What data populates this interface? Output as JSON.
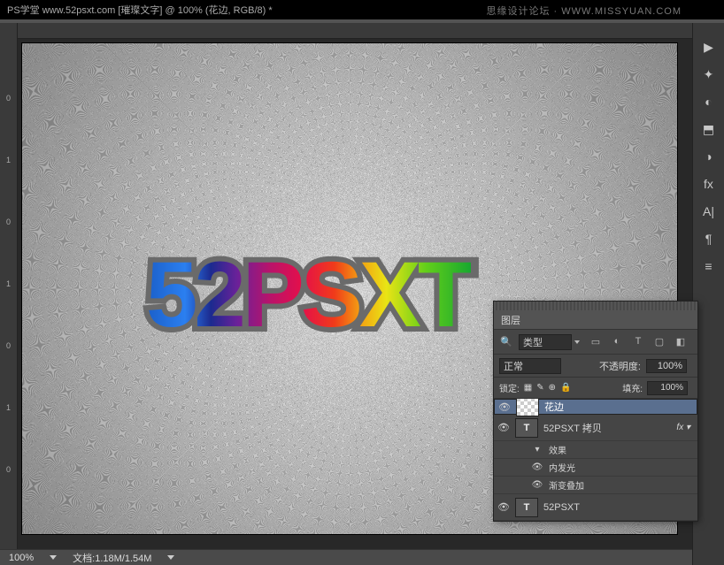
{
  "window": {
    "title": "PS学堂 www.52psxt.com [璀璨文字] @ 100% (花边, RGB/8) *"
  },
  "watermark": "思缘设计论坛 · WWW.MISSYUAN.COM",
  "canvas": {
    "text": "52PSXT"
  },
  "status": {
    "zoom": "100%",
    "doc": "文档:1.18M/1.54M"
  },
  "ruler_left": [
    "0",
    "1",
    "0",
    "1",
    "0",
    "1",
    "0"
  ],
  "tool_icons": [
    "▶",
    "✦",
    "◐",
    "⬒",
    "◑",
    "fx",
    "A|",
    "¶",
    "≡"
  ],
  "layers_panel": {
    "tab": "图层",
    "search": {
      "label": "类型"
    },
    "icons_row": [
      "▭",
      "◐",
      "T",
      "▢",
      "◧"
    ],
    "blend": "正常",
    "opacity_label": "不透明度:",
    "opacity_value": "100%",
    "lock_label": "锁定:",
    "lock_icons": [
      "▦",
      "✎",
      "⊕",
      "🔒"
    ],
    "fill_label": "填充:",
    "fill_value": "100%",
    "layers": [
      {
        "name": "花边",
        "thumb": "checker",
        "selected": true
      },
      {
        "name": "52PSXT 拷贝",
        "thumb": "T",
        "fx": true
      },
      {
        "name": "效果",
        "sub": true,
        "expand": true
      },
      {
        "name": "内发光",
        "sub": true
      },
      {
        "name": "渐变叠加",
        "sub": true
      },
      {
        "name": "52PSXT",
        "thumb": "T"
      }
    ]
  }
}
